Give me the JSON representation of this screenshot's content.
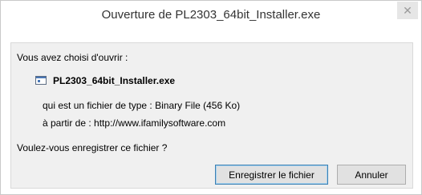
{
  "window": {
    "title": "Ouverture de PL2303_64bit_Installer.exe",
    "close_glyph": "✕"
  },
  "dialog": {
    "prompt": "Vous avez choisi d'ouvrir :",
    "file_icon": "application-file-icon",
    "filename": "PL2303_64bit_Installer.exe",
    "type_label": "qui est un fichier de type :",
    "type_value": "Binary File (456 Ko)",
    "source_label": "à partir de :",
    "source_value": "http://www.ifamilysoftware.com",
    "question": "Voulez-vous enregistrer ce fichier ?",
    "save_label": "Enregistrer le fichier",
    "cancel_label": "Annuler"
  },
  "colors": {
    "title_text": "#333333",
    "client_background": "#f0f0f0",
    "default_button_border": "#3c7fb1"
  }
}
